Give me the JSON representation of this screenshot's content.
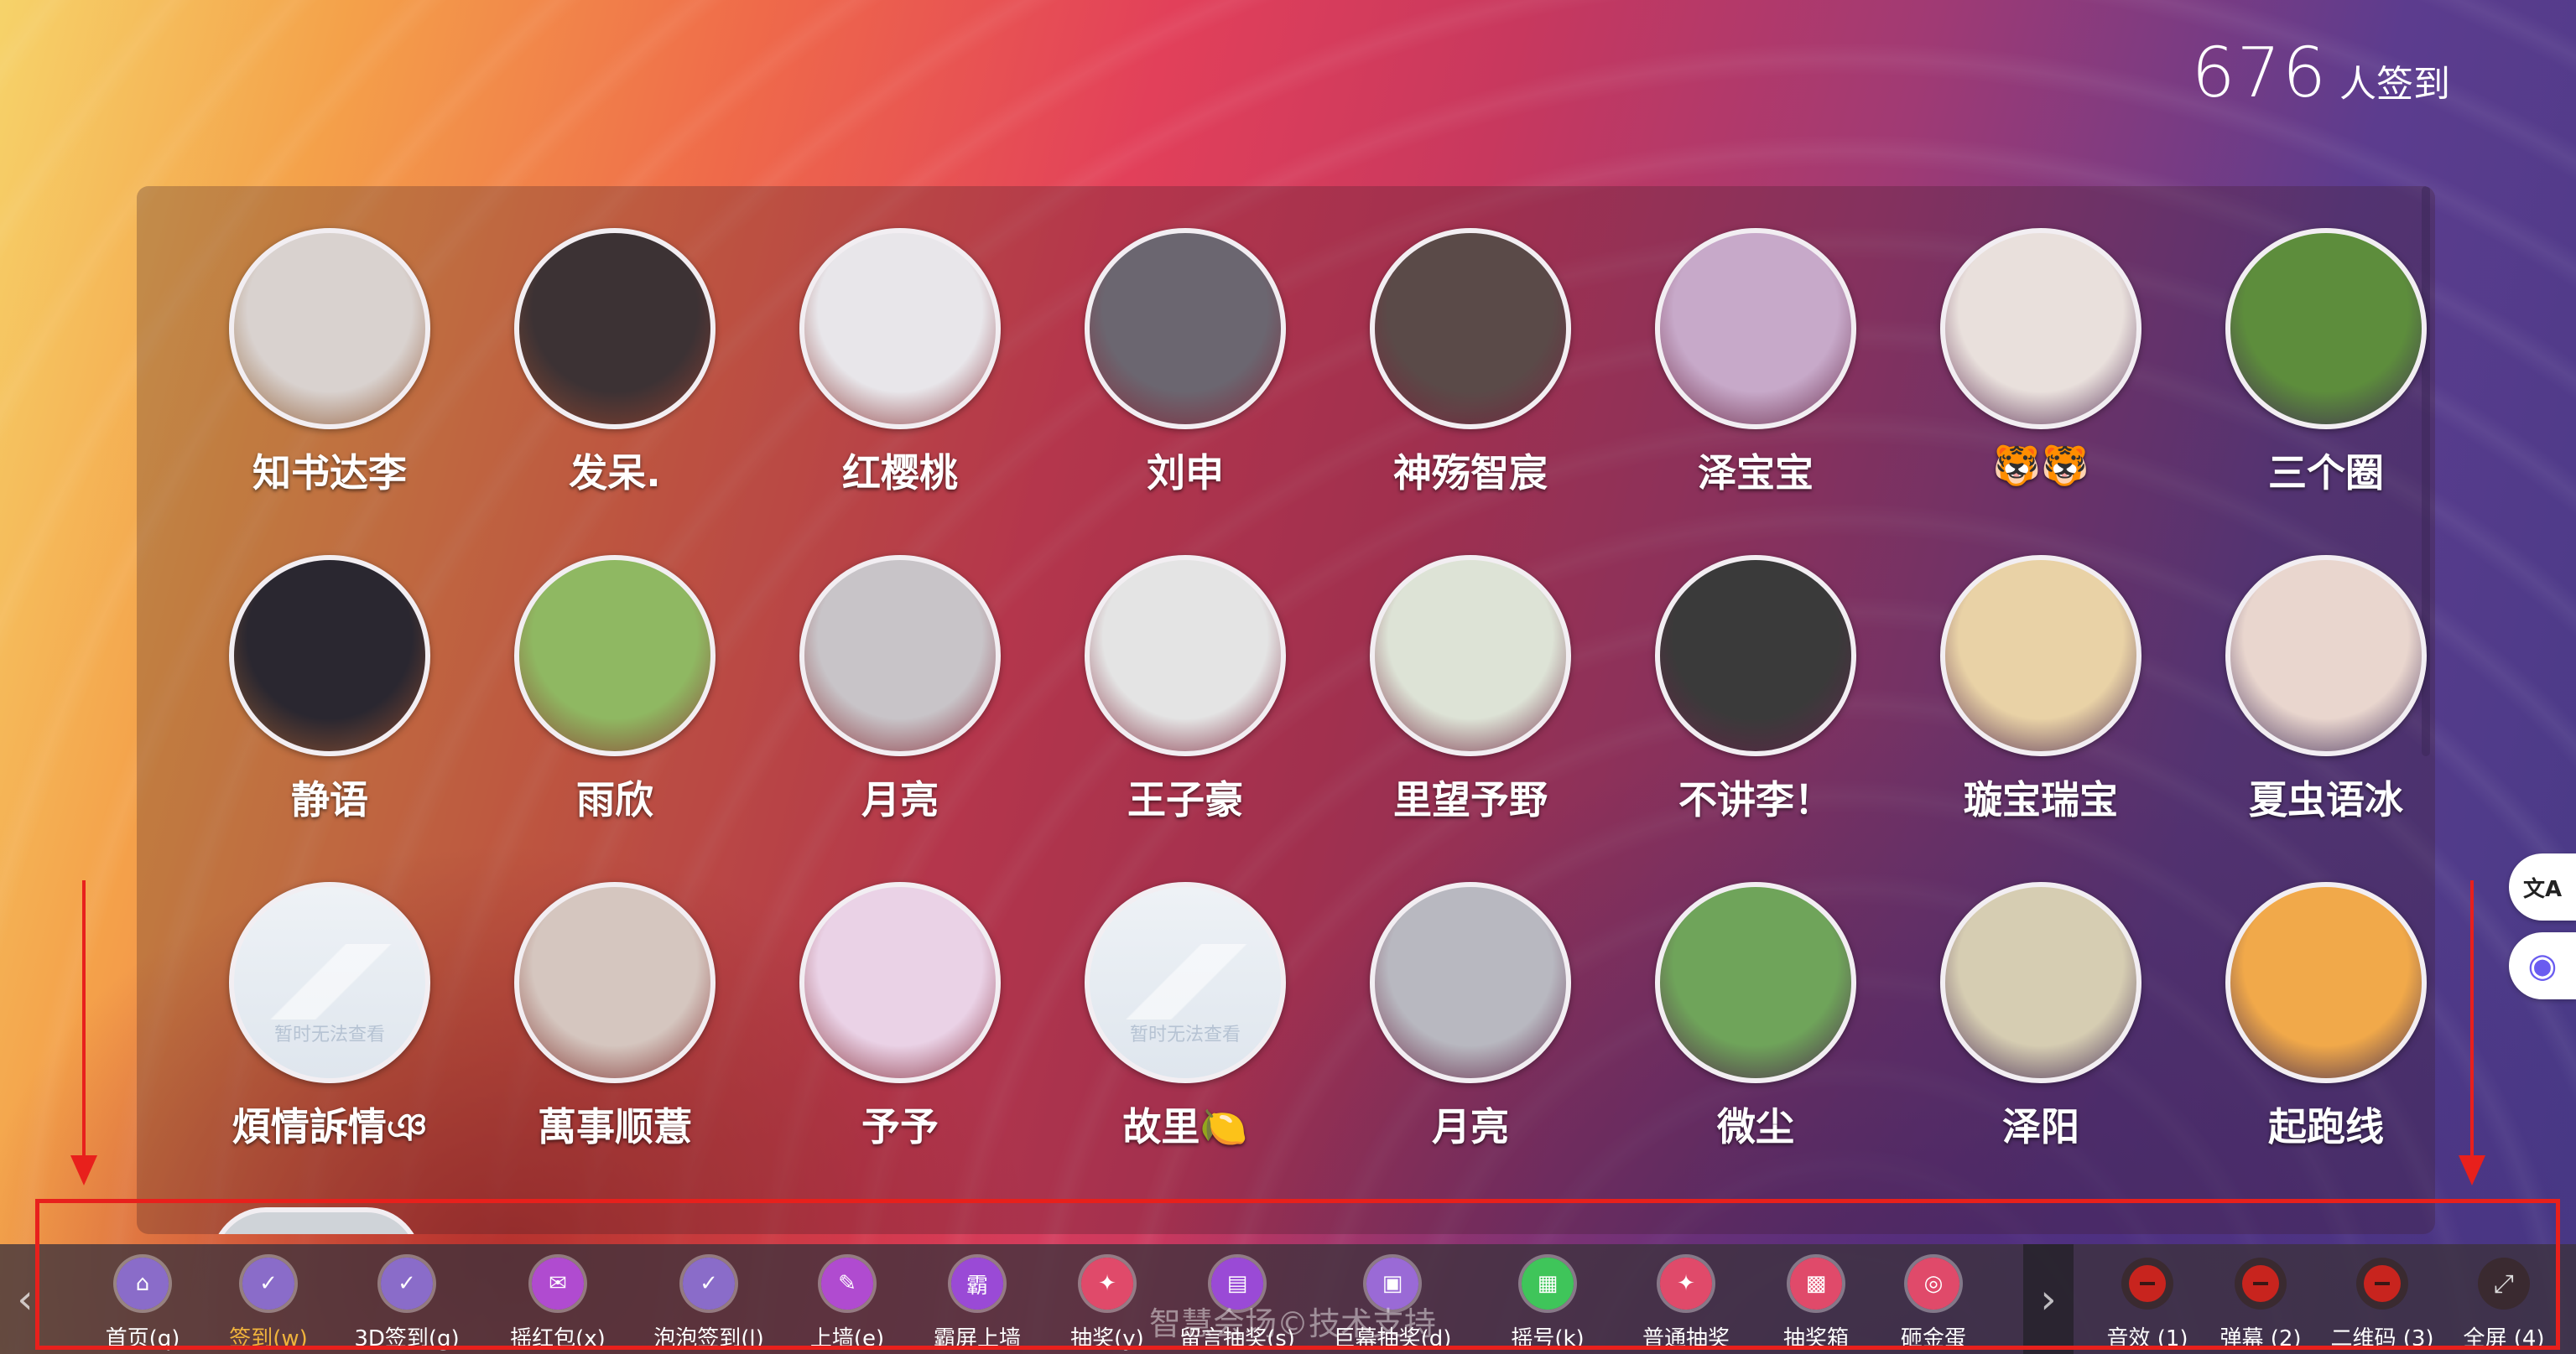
{
  "header": {
    "count": "676",
    "count_label": "人签到"
  },
  "users": [
    {
      "name": "知书达李",
      "color": "#d9d2cf"
    },
    {
      "name": "发呆.",
      "color": "#3c3234"
    },
    {
      "name": "红樱桃",
      "color": "#e8e6ea"
    },
    {
      "name": "刘申",
      "color": "#6b6670"
    },
    {
      "name": "神殇智宸",
      "color": "#5a4a48"
    },
    {
      "name": "泽宝宝",
      "color": "#c7a9c9"
    },
    {
      "name": "🐯🐯",
      "color": "#e9e0dc"
    },
    {
      "name": "三个圈",
      "color": "#5d8d3c"
    },
    {
      "name": "静语",
      "color": "#2a2730"
    },
    {
      "name": "雨欣",
      "color": "#8fb862"
    },
    {
      "name": "月亮",
      "color": "#c8c4c8"
    },
    {
      "name": "王子豪",
      "color": "#e4e4e4"
    },
    {
      "name": "里望予野",
      "color": "#dde3d6"
    },
    {
      "name": "不讲李！",
      "color": "#3a3a3a"
    },
    {
      "name": "璇宝瑞宝",
      "color": "#e9d2a6"
    },
    {
      "name": "夏虫语冰",
      "color": "#e9d6ce"
    },
    {
      "name": "煩情訴情ঞ",
      "color": "#e6ecf2",
      "placeholder": "暂时无法查看"
    },
    {
      "name": "萬事顺薏",
      "color": "#d5c6bf"
    },
    {
      "name": "予予",
      "color": "#ead2e6"
    },
    {
      "name": "故里🍋",
      "color": "#e6ecf2",
      "placeholder": "暂时无法查看"
    },
    {
      "name": "月亮",
      "color": "#b8b8c0"
    },
    {
      "name": "微尘",
      "color": "#6fa45a"
    },
    {
      "name": "泽阳",
      "color": "#d6cdb2"
    },
    {
      "name": "起跑线",
      "color": "#f1a94a"
    }
  ],
  "toolbar": {
    "items": [
      {
        "label": "首页(q)",
        "color": "#8a6cc9",
        "icon": "home-icon",
        "glyph": "⌂"
      },
      {
        "label": "签到(w)",
        "color": "#8a6cc9",
        "icon": "checkin-icon",
        "glyph": "✓",
        "active": true
      },
      {
        "label": "3D签到(g)",
        "color": "#8a6cc9",
        "icon": "3d-checkin-icon",
        "glyph": "✓"
      },
      {
        "label": "摇红包(x)",
        "color": "#b04bd0",
        "icon": "red-packet-icon",
        "glyph": "✉"
      },
      {
        "label": "泡泡签到(l)",
        "color": "#8a6cc9",
        "icon": "bubble-checkin-icon",
        "glyph": "✓"
      },
      {
        "label": "上墙(e)",
        "color": "#b04bd0",
        "icon": "message-wall-icon",
        "glyph": "✎"
      },
      {
        "label": "霸屏上墙",
        "color": "#9a4ad6",
        "icon": "dominate-screen-icon",
        "glyph": "霸"
      },
      {
        "label": "抽奖(y)",
        "color": "#e04a6a",
        "icon": "lottery-icon",
        "glyph": "✦"
      },
      {
        "label": "留言抽奖(s)",
        "color": "#9a4ad6",
        "icon": "message-lottery-icon",
        "glyph": "▤"
      },
      {
        "label": "巨幕抽奖(d)",
        "color": "#9a6ad6",
        "icon": "big-screen-lottery-icon",
        "glyph": "▣"
      },
      {
        "label": "摇号(k)",
        "color": "#3fc55a",
        "icon": "number-draw-icon",
        "glyph": "▦"
      },
      {
        "label": "普通抽奖",
        "color": "#e04a6a",
        "icon": "normal-lottery-icon",
        "glyph": "✦"
      },
      {
        "label": "抽奖箱",
        "color": "#e04a6a",
        "icon": "lottery-box-icon",
        "glyph": "▩"
      },
      {
        "label": "砸金蛋",
        "color": "#e04a6a",
        "icon": "golden-egg-icon",
        "glyph": "◎"
      }
    ],
    "right_items": [
      {
        "label": "音效 (1)",
        "icon": "sound-icon"
      },
      {
        "label": "弹幕 (2)",
        "icon": "danmaku-icon"
      },
      {
        "label": "二维码 (3)",
        "icon": "qrcode-icon"
      },
      {
        "label": "全屏 (4)",
        "icon": "fullscreen-icon"
      }
    ],
    "prev_glyph": "‹",
    "next_glyph": "›"
  },
  "watermark": "智慧会场©技术支持",
  "side_buttons": [
    {
      "icon": "translate-icon",
      "glyph": "文A"
    },
    {
      "icon": "assistant-icon",
      "glyph": "◉"
    }
  ]
}
